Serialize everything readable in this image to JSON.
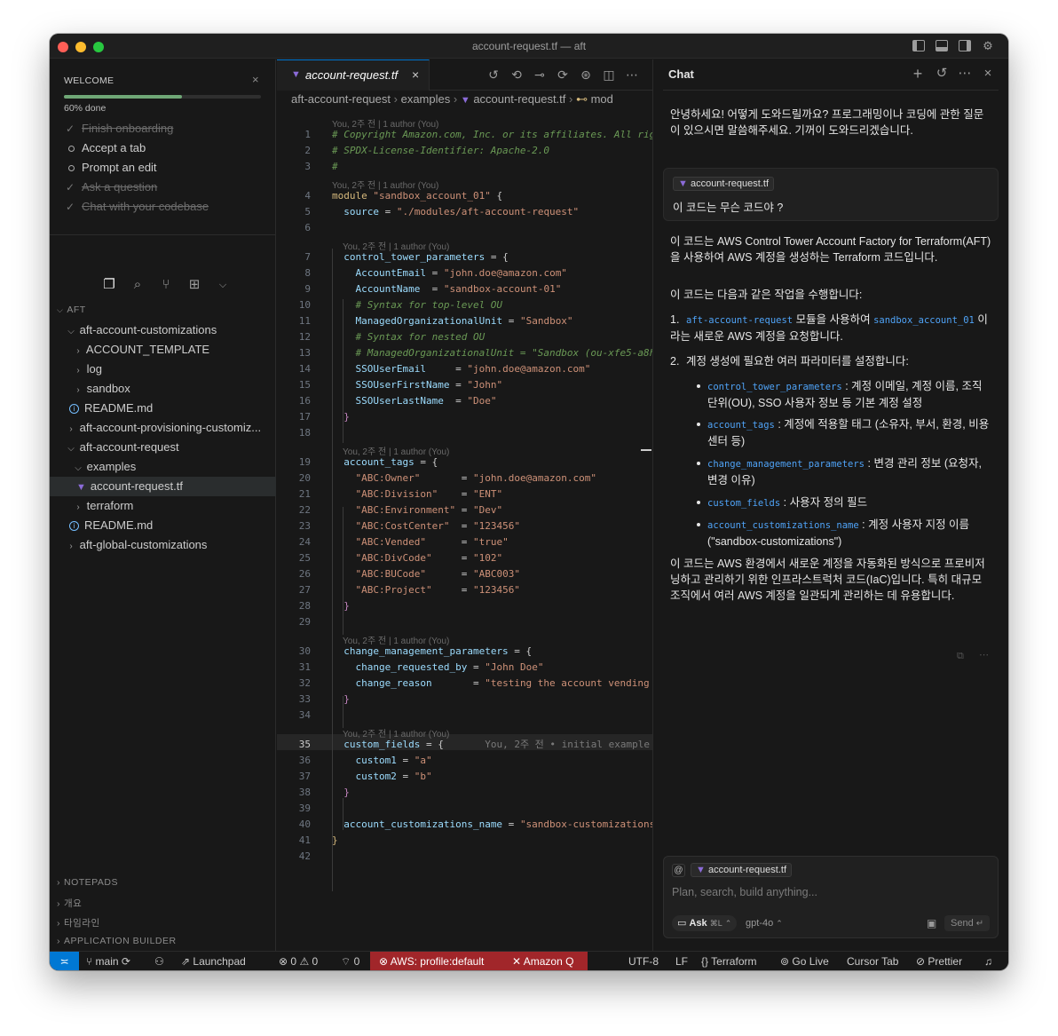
{
  "window": {
    "title": "account-request.tf — aft"
  },
  "welcome": {
    "title": "WELCOME",
    "progress_text": "60% done",
    "progress_percent": 60,
    "items": [
      {
        "label": "Finish onboarding",
        "done": true
      },
      {
        "label": "Accept a tab",
        "done": false
      },
      {
        "label": "Prompt an edit",
        "done": false
      },
      {
        "label": "Ask a question",
        "done": true
      },
      {
        "label": "Chat with your codebase",
        "done": true
      }
    ]
  },
  "explorer": {
    "root": "AFT",
    "items": [
      {
        "label": "aft-account-customizations",
        "type": "folder",
        "open": true
      },
      {
        "label": "ACCOUNT_TEMPLATE",
        "type": "folder"
      },
      {
        "label": "log",
        "type": "folder"
      },
      {
        "label": "sandbox",
        "type": "folder"
      },
      {
        "label": "README.md",
        "type": "info"
      },
      {
        "label": "aft-account-provisioning-customiz...",
        "type": "folder"
      },
      {
        "label": "aft-account-request",
        "type": "folder",
        "open": true
      },
      {
        "label": "examples",
        "type": "folder",
        "open": true
      },
      {
        "label": "account-request.tf",
        "type": "tf",
        "selected": true
      },
      {
        "label": "terraform",
        "type": "folder"
      },
      {
        "label": "README.md",
        "type": "info"
      },
      {
        "label": "aft-global-customizations",
        "type": "folder"
      }
    ],
    "bottom_sections": [
      "NOTEPADS",
      "개요",
      "타임라인",
      "APPLICATION BUILDER"
    ]
  },
  "editor": {
    "tab": "account-request.tf",
    "breadcrumb": [
      "aft-account-request",
      "examples",
      "account-request.tf",
      "mod"
    ],
    "blame": {
      "line1": "You, 2주 전 | 1 author (You)",
      "line4": "You, 2주 전 | 1 author (You)",
      "line7": "You, 2주 전 | 1 author (You)",
      "line19": "You, 2주 전 | 1 author (You)",
      "line30": "You, 2주 전 | 1 author (You)",
      "line35": "You, 2주 전 | 1 author (You)"
    },
    "inline_blame": "You, 2주 전 • initial example",
    "current_line": 35
  },
  "chat": {
    "title": "Chat",
    "assistant_greeting": "안녕하세요! 어떻게 도와드릴까요? 프로그래밍이나 코딩에 관한 질문이 있으시면 말씀해주세요. 기꺼이 도와드리겠습니다.",
    "user_chip": "account-request.tf",
    "user_question": "이 코드는 무슨 코드야 ?",
    "answer_intro": "이 코드는 AWS Control Tower Account Factory for Terraform(AFT)을 사용하여 AWS 계정을 생성하는 Terraform 코드입니다.",
    "answer_sub": "이 코드는 다음과 같은 작업을 수행합니다:",
    "step1_pre": "aft-account-request",
    "step1_mid": "모듈을 사용하여",
    "step1_code": "sandbox_account_01",
    "step1_post": "이라는 새로운 AWS 계정을 요청합니다.",
    "step2": "계정 생성에 필요한 여러 파라미터를 설정합니다:",
    "bullets": [
      {
        "code": "control_tower_parameters",
        "text": ": 계정 이메일, 계정 이름, 조직 단위(OU), SSO 사용자 정보 등 기본 계정 설정"
      },
      {
        "code": "account_tags",
        "text": ": 계정에 적용할 태그 (소유자, 부서, 환경, 비용 센터 등)"
      },
      {
        "code": "change_management_parameters",
        "text": ": 변경 관리 정보 (요청자, 변경 이유)"
      },
      {
        "code": "custom_fields",
        "text": ": 사용자 정의 필드"
      },
      {
        "code": "account_customizations_name",
        "text": ": 계정 사용자 지정 이름 (\"sandbox-customizations\")"
      }
    ],
    "answer_outro": "이 코드는 AWS 환경에서 새로운 계정을 자동화된 방식으로 프로비저닝하고 관리하기 위한 인프라스트럭처 코드(IaC)입니다. 특히 대규모 조직에서 여러 AWS 계정을 일관되게 관리하는 데 유용합니다.",
    "input_chip": "account-request.tf",
    "input_placeholder": "Plan, search, build anything...",
    "mode_label": "Ask",
    "mode_shortcut": "⌘L",
    "model": "gpt-4o",
    "send_label": "Send"
  },
  "statusbar": {
    "branch": "main",
    "launchpad": "Launchpad",
    "errors": "0",
    "warnings": "0",
    "ports": "0",
    "aws": "AWS: profile:default",
    "amazonq": "Amazon Q",
    "encoding": "UTF-8",
    "eol": "LF",
    "language": "Terraform",
    "golive": "Go Live",
    "cursortab": "Cursor Tab",
    "prettier": "Prettier"
  },
  "colors": {
    "accent": "#0078d4",
    "progress": "#6fa776",
    "terraform": "#8b6bd8",
    "status_red": "#a1262a"
  }
}
